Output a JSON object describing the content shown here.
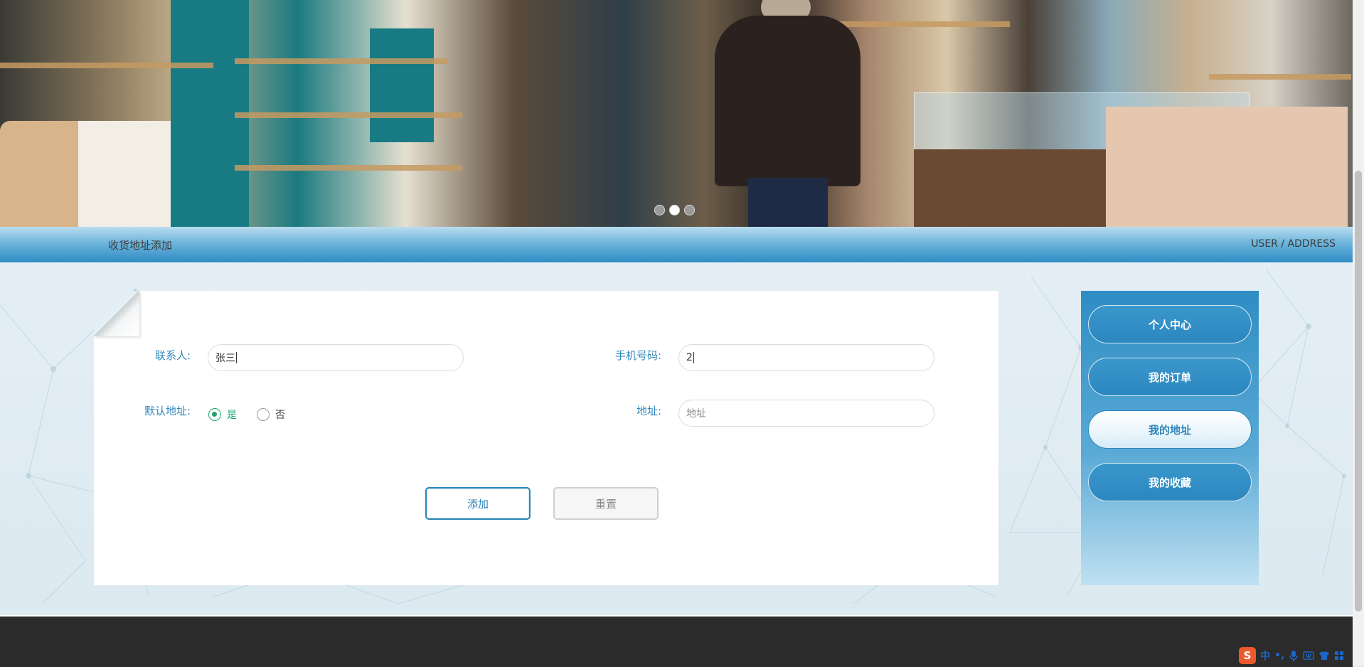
{
  "page": {
    "breadcrumb_title": "收货地址添加",
    "breadcrumb_en": "USER / ADDRESS"
  },
  "banner": {
    "slides": 3,
    "active_slide": 2
  },
  "form": {
    "contact": {
      "label": "联系人:",
      "value": "张三"
    },
    "phone": {
      "label": "手机号码:",
      "value": "2"
    },
    "default_address": {
      "label": "默认地址:",
      "options": [
        {
          "label": "是",
          "checked": true
        },
        {
          "label": "否",
          "checked": false
        }
      ]
    },
    "address": {
      "label": "地址:",
      "value": "",
      "placeholder": "地址"
    },
    "add_label": "添加",
    "reset_label": "重置"
  },
  "sidebar": {
    "items": [
      {
        "label": "个人中心",
        "active": false
      },
      {
        "label": "我的订单",
        "active": false
      },
      {
        "label": "我的地址",
        "active": true
      },
      {
        "label": "我的收藏",
        "active": false
      }
    ]
  },
  "ime": {
    "logo": "S",
    "mode": "中",
    "punct": "•,",
    "icons": [
      "microphone-icon",
      "keyboard-icon",
      "shirt-icon",
      "grid-icon"
    ]
  },
  "colors": {
    "accent": "#2f86ba",
    "radio_checked": "#22a36d",
    "footer": "#2b2b2b"
  }
}
